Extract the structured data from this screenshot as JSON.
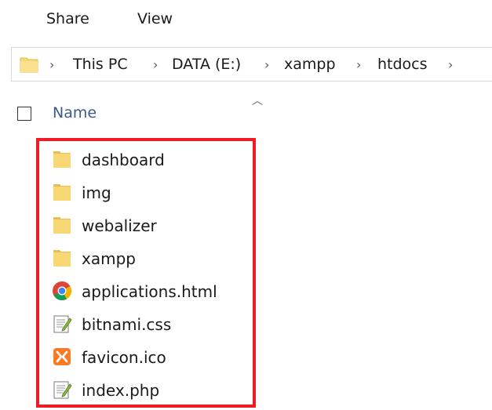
{
  "ribbon": {
    "tabs": [
      {
        "label": "Share"
      },
      {
        "label": "View"
      }
    ]
  },
  "address_bar": {
    "crumbs": [
      "This PC",
      "DATA (E:)",
      "xampp",
      "htdocs"
    ],
    "folder_icon": "folder-icon",
    "separator_icon": "chevron-right-icon"
  },
  "columns": {
    "name_header": "Name",
    "sort_icon": "sort-up-icon"
  },
  "files": [
    {
      "name": "dashboard",
      "icon": "folder-icon"
    },
    {
      "name": "img",
      "icon": "folder-icon"
    },
    {
      "name": "webalizer",
      "icon": "folder-icon"
    },
    {
      "name": "xampp",
      "icon": "folder-icon"
    },
    {
      "name": "applications.html",
      "icon": "chrome-icon"
    },
    {
      "name": "bitnami.css",
      "icon": "text-document-icon"
    },
    {
      "name": "favicon.ico",
      "icon": "xampp-icon"
    },
    {
      "name": "index.php",
      "icon": "text-document-icon"
    }
  ],
  "colors": {
    "highlight": "#ee1b24",
    "folder": "#f8d775",
    "header_text": "#3c5a8a"
  }
}
